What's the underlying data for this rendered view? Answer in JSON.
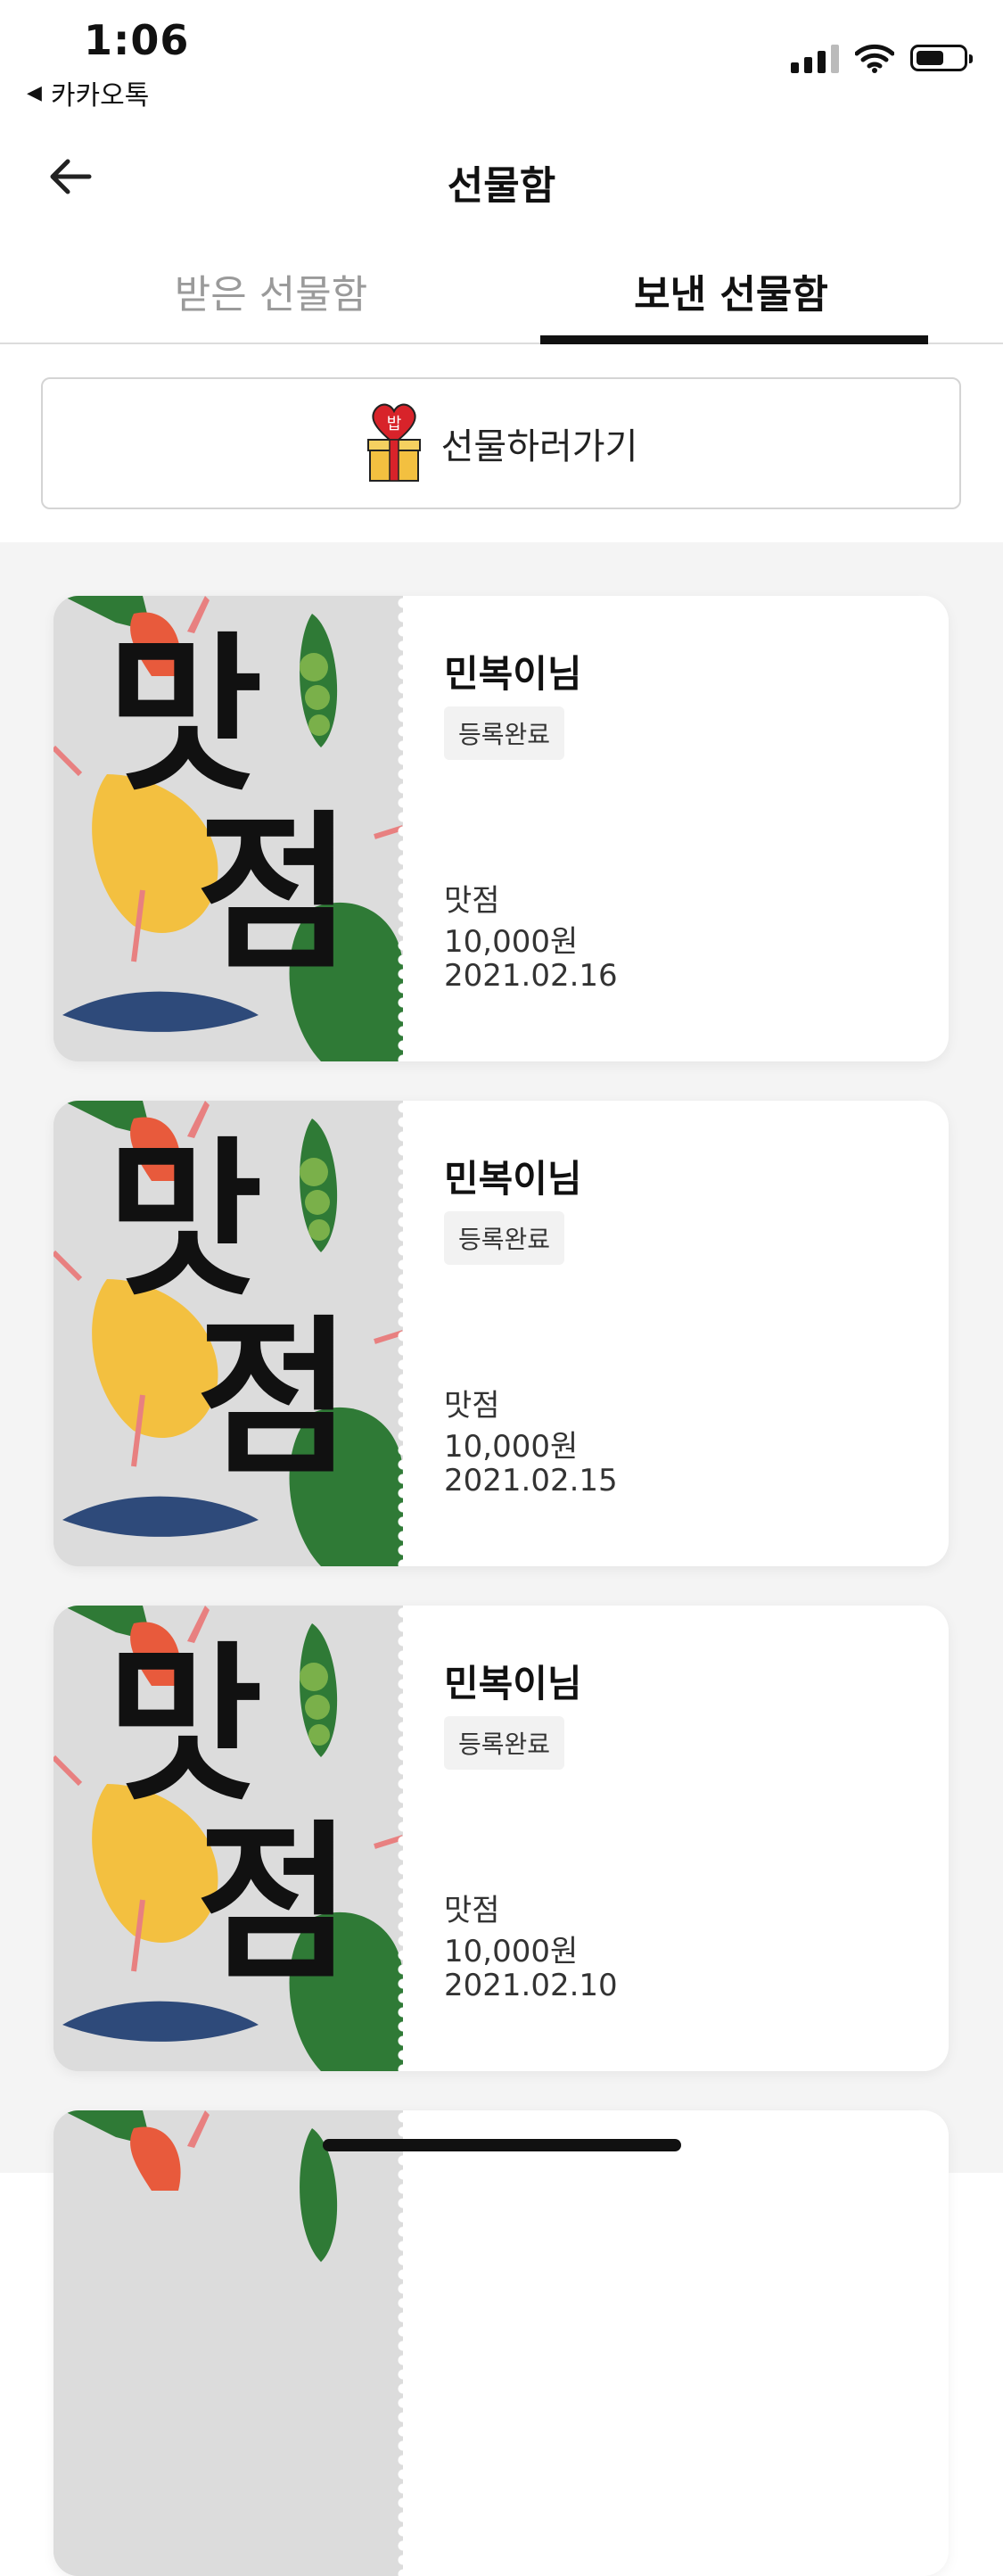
{
  "status_bar": {
    "time": "1:06",
    "back_app": "카카오톡"
  },
  "header": {
    "title": "선물함"
  },
  "tabs": [
    {
      "label": "받은 선물함",
      "active": false
    },
    {
      "label": "보낸 선물함",
      "active": true
    }
  ],
  "gift_button": {
    "label": "선물하러가기",
    "icon_text": "밥"
  },
  "coupon_art": {
    "line1": "맛",
    "line2": "점"
  },
  "cards": [
    {
      "recipient": "민복이님",
      "status": "등록완료",
      "item": "맛점",
      "price": "10,000원",
      "date": "2021.02.16"
    },
    {
      "recipient": "민복이님",
      "status": "등록완료",
      "item": "맛점",
      "price": "10,000원",
      "date": "2021.02.15"
    },
    {
      "recipient": "민복이님",
      "status": "등록완료",
      "item": "맛점",
      "price": "10,000원",
      "date": "2021.02.10"
    }
  ],
  "colors": {
    "accent": "#111111",
    "list_bg": "#f4f4f4",
    "coupon_bg": "#dcdcdc",
    "carrot": "#e85a3c",
    "pear": "#f3c040",
    "leaf": "#2f7a36",
    "fish": "#2e4a7a"
  }
}
